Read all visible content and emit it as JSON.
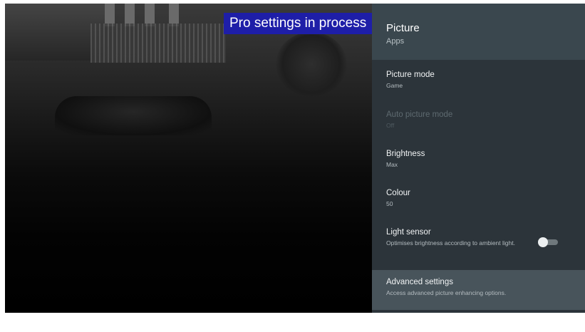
{
  "toast": {
    "text": "Pro settings in process"
  },
  "panel": {
    "title": "Picture",
    "subtitle": "Apps",
    "items": [
      {
        "title": "Picture mode",
        "sub": "Game"
      },
      {
        "title": "Auto picture mode",
        "sub": "Off",
        "disabled": true
      },
      {
        "title": "Brightness",
        "sub": "Max"
      },
      {
        "title": "Colour",
        "sub": "50"
      },
      {
        "title": "Light sensor",
        "sub": "Optimises brightness according to ambient light.",
        "toggle": "off"
      },
      {
        "title": "Advanced settings",
        "sub": "Access advanced picture enhancing options.",
        "focused": true
      }
    ]
  },
  "colors": {
    "toast_bg": "#1e1ea8",
    "panel_bg": "#2c343a",
    "header_bg": "#3a474e",
    "focused_bg": "#48545b"
  }
}
